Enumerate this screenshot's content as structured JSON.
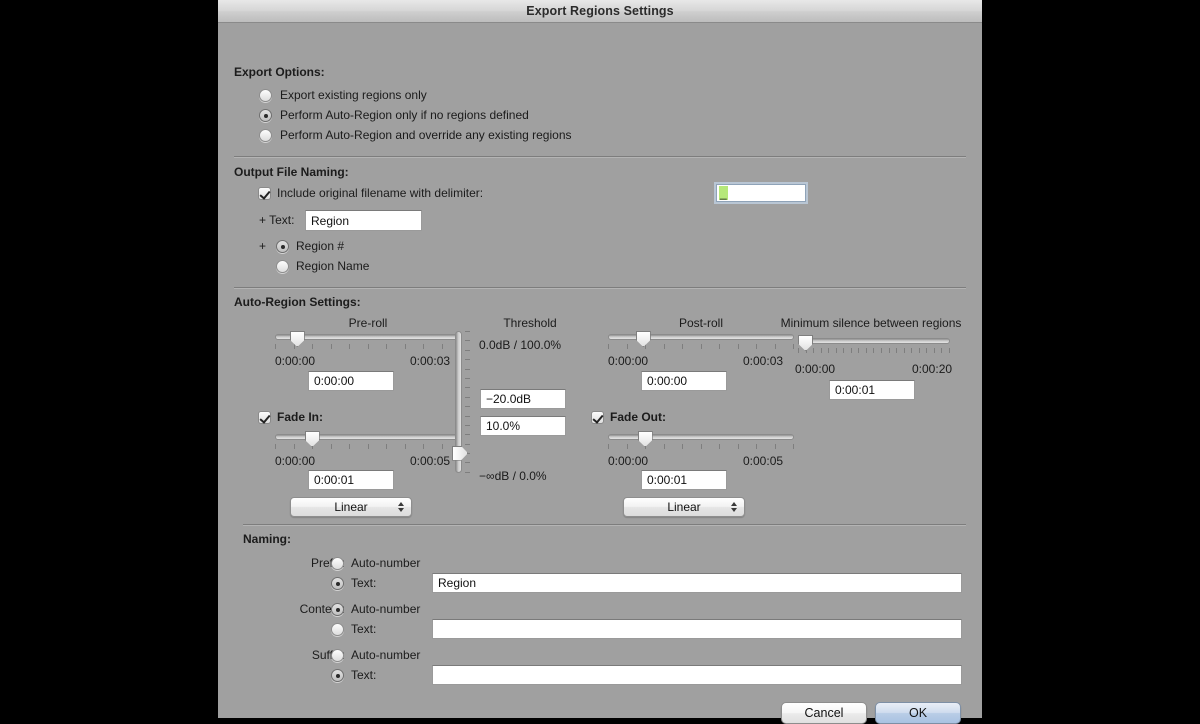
{
  "window": {
    "title": "Export Regions Settings"
  },
  "export_options": {
    "heading": "Export Options:",
    "items": [
      {
        "label": "Export existing regions only",
        "selected": false
      },
      {
        "label": "Perform Auto-Region only if no regions defined",
        "selected": true
      },
      {
        "label": "Perform Auto-Region and override any existing regions",
        "selected": false
      }
    ]
  },
  "output_naming": {
    "heading": "Output File Naming:",
    "include_original": {
      "label": "Include original filename with delimiter:",
      "checked": true
    },
    "delimiter_value": "_",
    "text_label": "+ Text:",
    "text_value": "Region",
    "plus_label": "+",
    "region_number": {
      "label": "Region #",
      "selected": true
    },
    "region_name": {
      "label": "Region Name",
      "selected": false
    }
  },
  "auto_region": {
    "heading": "Auto-Region Settings:",
    "preroll": {
      "title": "Pre-roll",
      "min_label": "0:00:00",
      "max_label": "0:00:03",
      "value": "0:00:00",
      "knob_percent": 12,
      "tick_count": 11
    },
    "threshold": {
      "title": "Threshold",
      "top_label": "0.0dB / 100.0%",
      "bottom_label": "−∞dB / 0.0%",
      "db_value": "−20.0dB",
      "percent_value": "10.0%",
      "knob_percent": 86,
      "tick_count": 16
    },
    "postroll": {
      "title": "Post-roll",
      "min_label": "0:00:00",
      "max_label": "0:00:03",
      "value": "0:00:00",
      "knob_percent": 19,
      "tick_count": 11
    },
    "min_silence": {
      "title": "Minimum silence between regions",
      "min_label": "0:00:00",
      "max_label": "0:00:20",
      "value": "0:00:01",
      "knob_percent": 5,
      "tick_count": 21
    },
    "fade_in": {
      "label": "Fade In:",
      "checked": true,
      "min_label": "0:00:00",
      "max_label": "0:00:05",
      "value": "0:00:01",
      "knob_percent": 20,
      "tick_count": 11,
      "curve": "Linear"
    },
    "fade_out": {
      "label": "Fade Out:",
      "checked": true,
      "min_label": "0:00:00",
      "max_label": "0:00:05",
      "value": "0:00:01",
      "knob_percent": 20,
      "tick_count": 11,
      "curve": "Linear"
    }
  },
  "naming": {
    "heading": "Naming:",
    "rows": [
      {
        "label": "Prefix:",
        "auto_label": "Auto-number",
        "text_label": "Text:",
        "auto_selected": false,
        "text_selected": true,
        "value": "Region"
      },
      {
        "label": "Content:",
        "auto_label": "Auto-number",
        "text_label": "Text:",
        "auto_selected": true,
        "text_selected": false,
        "value": ""
      },
      {
        "label": "Suffix:",
        "auto_label": "Auto-number",
        "text_label": "Text:",
        "auto_selected": false,
        "text_selected": true,
        "value": ""
      }
    ]
  },
  "footer": {
    "cancel": "Cancel",
    "ok": "OK"
  }
}
